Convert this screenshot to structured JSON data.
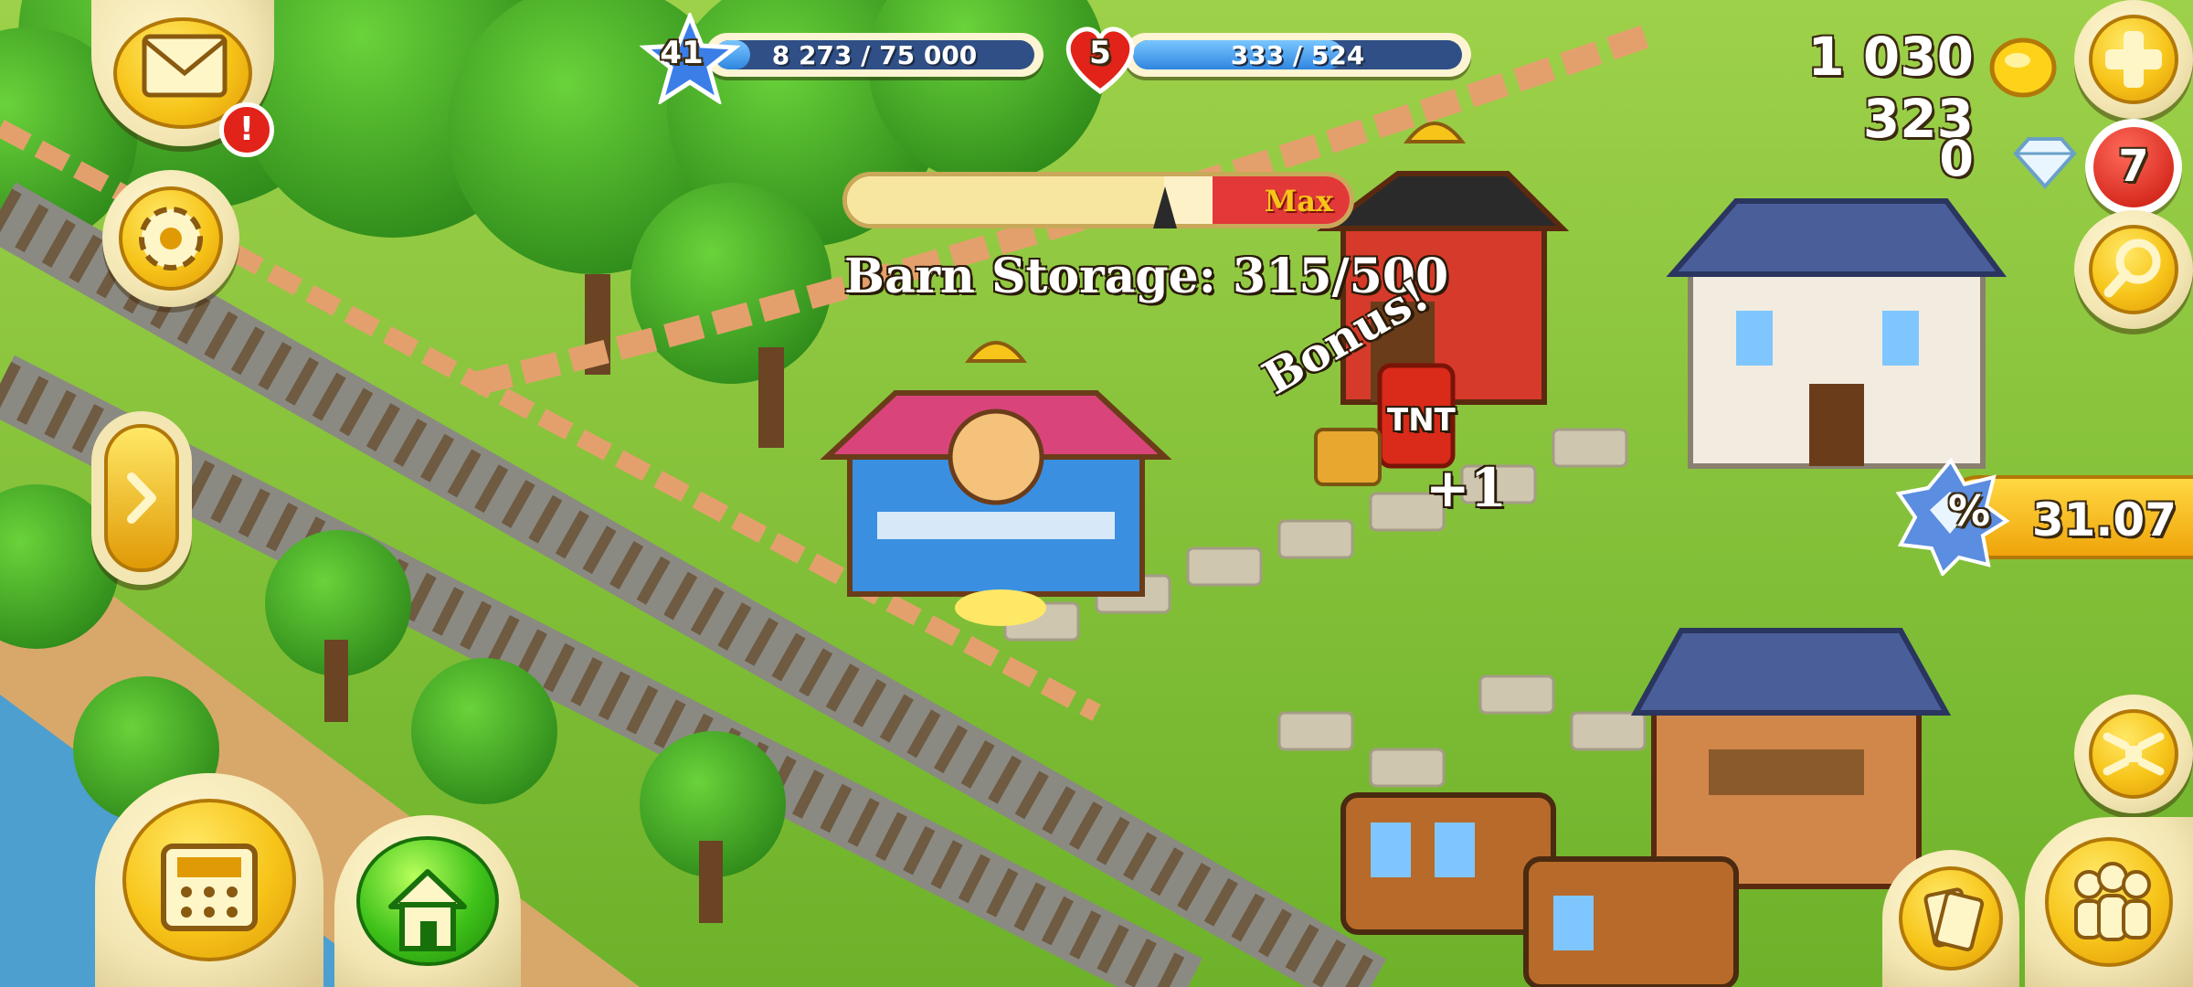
{
  "hud": {
    "level": {
      "value": "41",
      "xp_text": "8 273 / 75 000",
      "xp_progress": 0.11
    },
    "reputation": {
      "value": "5",
      "text": "333 / 524",
      "progress": 0.64
    },
    "coins": {
      "value": "1 030 323"
    },
    "diamonds": {
      "value": "0"
    },
    "badge_count": "7",
    "mail_alert": "!",
    "sale": {
      "value": "31.07",
      "symbol": "%"
    }
  },
  "barn": {
    "label": "Barn Storage: 315/500",
    "max_label": "Max",
    "used": 315,
    "capacity": 500
  },
  "popups": {
    "bonus": "Bonus!",
    "plus_one": "+1",
    "tnt": "TNT"
  },
  "icons": {
    "mail": "envelope-icon",
    "settings": "gear-icon",
    "expand": "chevron-right-icon",
    "shop": "cash-register-icon",
    "home": "house-icon",
    "add": "plus-icon",
    "search": "magnifier-icon",
    "fullscreen": "arrows-icon",
    "friends": "people-icon",
    "cards": "cards-icon"
  },
  "colors": {
    "grass": "#7cc23a",
    "accent_gold": "#f7c51a",
    "bar_blue": "#2f86e0",
    "alert_red": "#e2231a"
  }
}
